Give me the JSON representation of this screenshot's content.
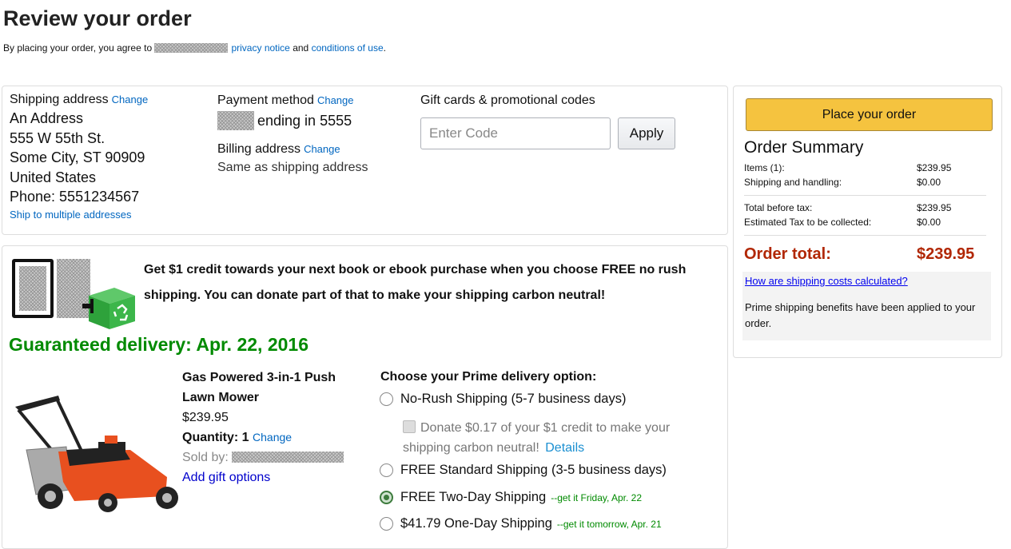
{
  "header": {
    "title": "Review your order",
    "agree_prefix": "By placing your order, you agree to",
    "privacy_link": "privacy notice",
    "and_text": "and",
    "conditions_link": "conditions of use",
    "period": "."
  },
  "shipping": {
    "label": "Shipping address",
    "change": "Change",
    "lines": [
      "An Address",
      "555 W 55th St.",
      "Some City, ST 90909",
      "United States",
      "Phone: 5551234567"
    ],
    "multi_link": "Ship to multiple addresses"
  },
  "payment": {
    "label": "Payment method",
    "change": "Change",
    "ending": "ending in 5555",
    "billing_label": "Billing address",
    "billing_change": "Change",
    "billing_value": "Same as shipping address"
  },
  "gift": {
    "label": "Gift cards & promotional codes",
    "placeholder": "Enter Code",
    "apply": "Apply"
  },
  "summary": {
    "place_order": "Place your order",
    "title": "Order Summary",
    "items_label": "Items (1):",
    "items_value": "$239.95",
    "shipping_label": "Shipping and handling:",
    "shipping_value": "$0.00",
    "before_tax_label": "Total before tax:",
    "before_tax_value": "$239.95",
    "tax_label": "Estimated Tax to be collected:",
    "tax_value": "$0.00",
    "total_label": "Order total:",
    "total_value": "$239.95",
    "calc_link": "How are shipping costs calculated?",
    "prime_note": "Prime shipping benefits have been applied to your order."
  },
  "promo": {
    "text": "Get $1 credit towards your next book or ebook purchase when you choose FREE no rush shipping. You can donate part of that to make your shipping carbon neutral!"
  },
  "delivery": {
    "guaranteed": "Guaranteed delivery: Apr. 22, 2016",
    "product_name": "Gas Powered 3-in-1 Push Lawn Mower",
    "price": "$239.95",
    "quantity_label": "Quantity:",
    "quantity_value": "1",
    "quantity_change": "Change",
    "sold_by": "Sold by:",
    "gift_options": "Add gift options",
    "options_heading": "Choose your Prime delivery option:",
    "opt_norush": "No-Rush Shipping (5-7 business days)",
    "donate_text": "Donate $0.17 of your $1 credit to make your shipping carbon neutral!",
    "donate_details": "Details",
    "opt_standard": "FREE Standard Shipping (3-5 business days)",
    "opt_twoday": "FREE Two-Day Shipping",
    "opt_twoday_note": "--get it Friday, Apr. 22",
    "opt_oneday": "$41.79 One-Day Shipping",
    "opt_oneday_note": "--get it tomorrow, Apr. 21"
  },
  "colors": {
    "link": "#0066c0",
    "button_yellow": "#f5c33f",
    "total_red": "#b12704",
    "guaranteed_green": "#008a00"
  }
}
